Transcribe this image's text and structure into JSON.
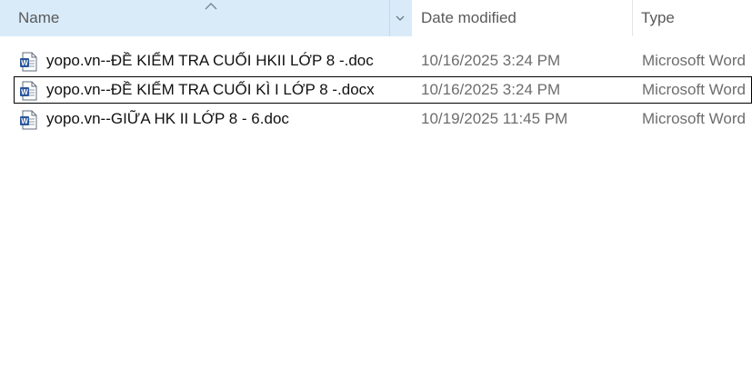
{
  "header": {
    "name_label": "Name",
    "date_label": "Date modified",
    "type_label": "Type",
    "sort_direction": "ascending",
    "sorted_column": "Name"
  },
  "colors": {
    "header_selected_bg": "#d9ebf9",
    "row_focus_border": "#000000",
    "word_icon_blue": "#2b579a"
  },
  "files": [
    {
      "name": "yopo.vn--ĐỀ KIỂM TRA CUỐI HKII LỚP 8 -.doc",
      "date": "10/16/2025 3:24 PM",
      "type": "Microsoft Word",
      "icon": "word-document-icon",
      "focused": false
    },
    {
      "name": "yopo.vn--ĐỀ KIỂM TRA CUỐI KÌ I LỚP 8 -.docx",
      "date": "10/16/2025 3:24 PM",
      "type": "Microsoft Word",
      "icon": "word-document-icon",
      "focused": true
    },
    {
      "name": "yopo.vn--GIỮA HK II LỚP 8 - 6.doc",
      "date": "10/19/2025 11:45 PM",
      "type": "Microsoft Word",
      "icon": "word-document-icon",
      "focused": false
    }
  ]
}
